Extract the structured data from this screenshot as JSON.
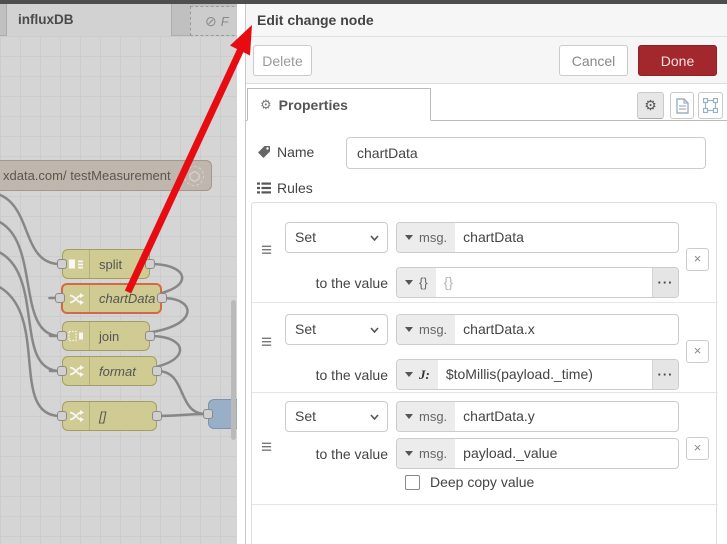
{
  "icons": {
    "gear": "⚙",
    "prohibit": "⊘",
    "handle": "≡",
    "remove": "×",
    "ellipsis": "···"
  },
  "workspace": {
    "tabs": [
      {
        "label": "influxDB"
      },
      {
        "label": "F"
      }
    ],
    "influx_node_label": "xdata.com/ testMeasurement",
    "node_labels": {
      "split": "split",
      "chartData": "chartData",
      "join": "join",
      "format": "format",
      "array": "[]"
    }
  },
  "dialog": {
    "title": "Edit change node",
    "delete_label": "Delete",
    "cancel_label": "Cancel",
    "done_label": "Done",
    "properties_tab_label": "Properties",
    "name_label": "Name",
    "name_value": "chartData",
    "rules_label": "Rules",
    "to_value_label": "to the value",
    "deep_copy_label": "Deep copy value",
    "rules": [
      {
        "action": "Set",
        "prop_type": "msg.",
        "prop": "chartData",
        "value_type": "{}",
        "value": "{}"
      },
      {
        "action": "Set",
        "prop_type": "msg.",
        "prop": "chartData.x",
        "value_type": "J:",
        "value": "$toMillis(payload._time)"
      },
      {
        "action": "Set",
        "prop_type": "msg.",
        "prop": "chartData.y",
        "value_type": "msg.",
        "value": "payload._value"
      }
    ]
  },
  "colors": {
    "done_bg": "#a2282e",
    "selected_node_border": "#dd6a44",
    "arrow_red": "#e60c12",
    "node_yellow": "#d6d195"
  }
}
